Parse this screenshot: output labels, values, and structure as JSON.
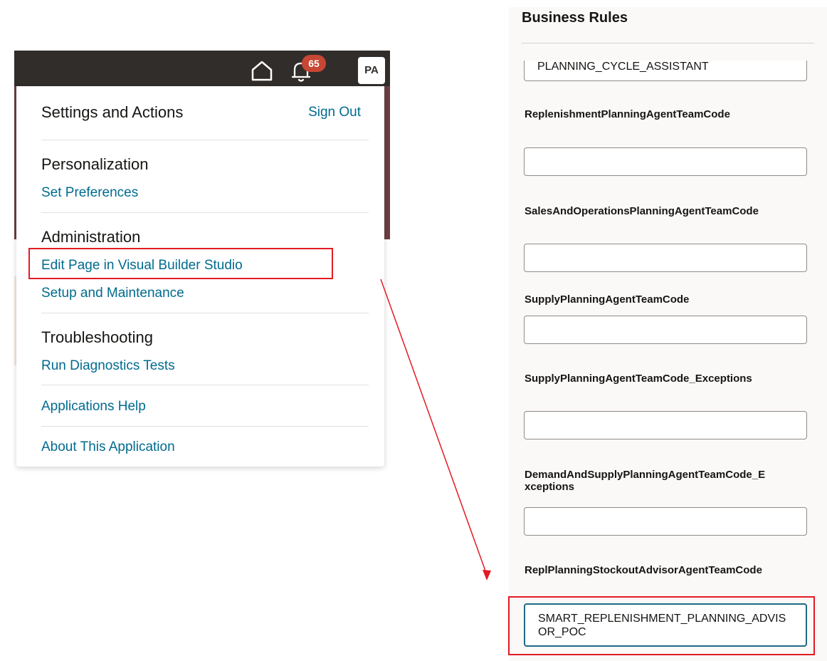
{
  "header": {
    "notification_count": "65",
    "avatar_initials": "PA",
    "icons": [
      "home-icon",
      "bell-icon"
    ]
  },
  "menu": {
    "title": "Settings and Actions",
    "sign_out": "Sign Out",
    "sections": [
      {
        "heading": "Personalization",
        "links": [
          "Set Preferences"
        ]
      },
      {
        "heading": "Administration",
        "links": [
          "Edit Page in Visual Builder Studio",
          "Setup and Maintenance"
        ]
      },
      {
        "heading": "Troubleshooting",
        "links": [
          "Run Diagnostics Tests"
        ]
      }
    ],
    "extra_links": [
      "Applications Help",
      "About This Application"
    ]
  },
  "form": {
    "title": "Business Rules",
    "fields": [
      {
        "label": "",
        "value": "PLANNING_CYCLE_ASSISTANT"
      },
      {
        "label": "ReplenishmentPlanningAgentTeamCode",
        "value": ""
      },
      {
        "label": "SalesAndOperationsPlanningAgentTeamCode",
        "value": ""
      },
      {
        "label": "SupplyPlanningAgentTeamCode",
        "value": ""
      },
      {
        "label": "SupplyPlanningAgentTeamCode_Exceptions",
        "value": ""
      },
      {
        "label": "DemandAndSupplyPlanningAgentTeamCode_Exceptions",
        "value": ""
      },
      {
        "label": "ReplPlanningStockoutAdvisorAgentTeamCode",
        "value": "SMART_REPLENISHMENT_PLANNING_ADVISOR_POC"
      }
    ]
  },
  "colors": {
    "accent_link": "#006b8f",
    "header_bg": "#312d2a",
    "badge": "#c74634",
    "highlight": "#e31b23"
  }
}
